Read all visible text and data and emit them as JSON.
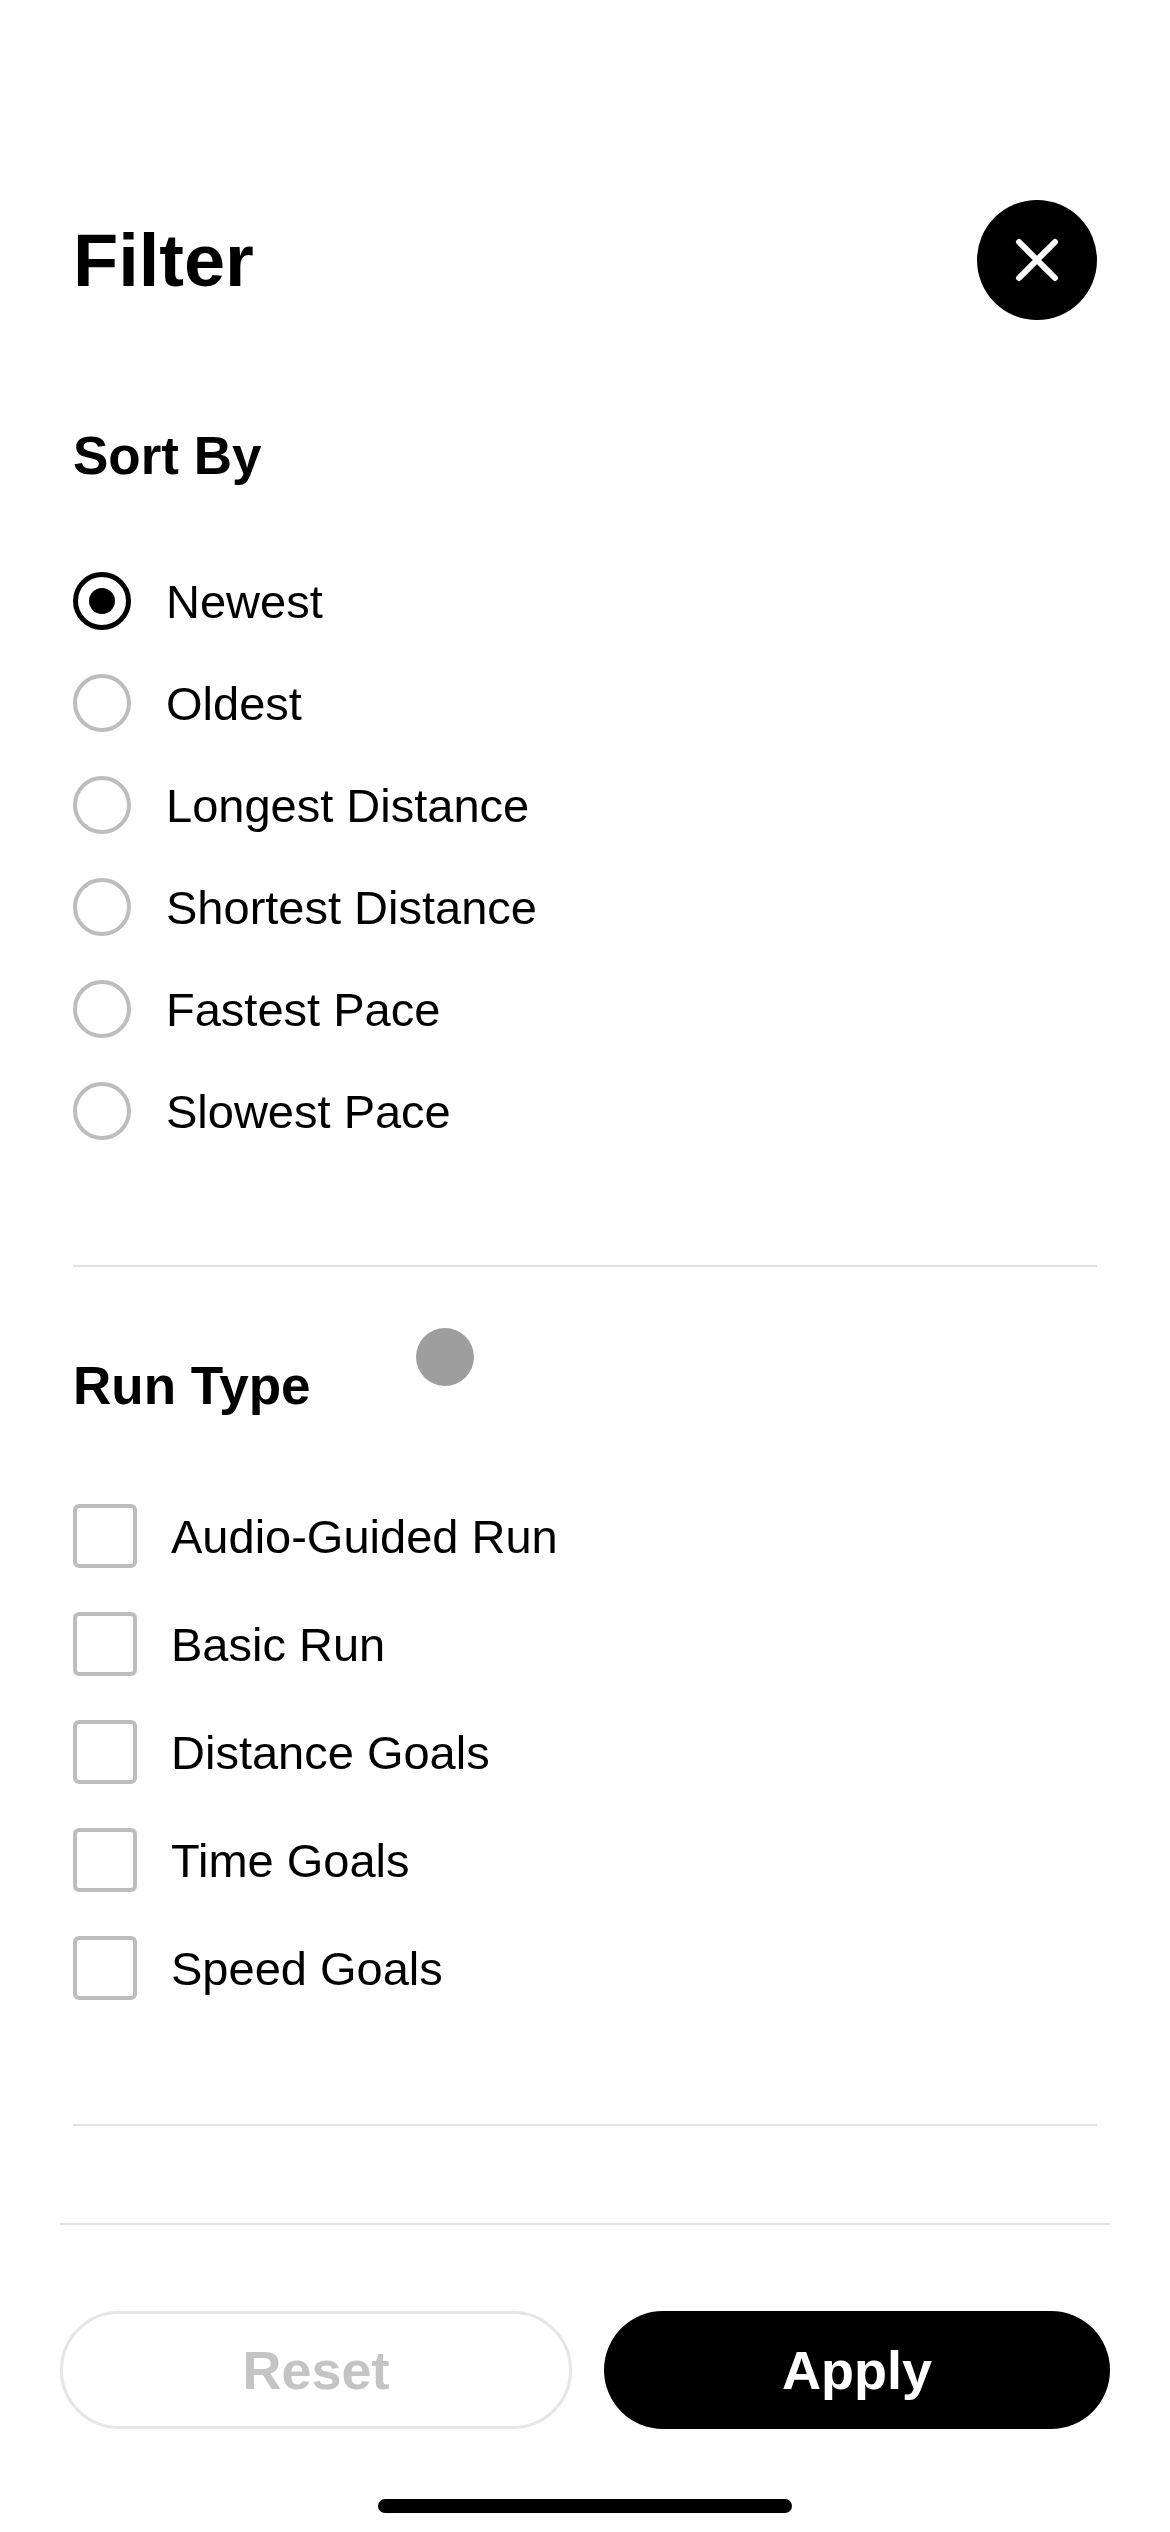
{
  "header": {
    "title": "Filter"
  },
  "sort": {
    "heading": "Sort By",
    "options": [
      {
        "label": "Newest",
        "selected": true
      },
      {
        "label": "Oldest",
        "selected": false
      },
      {
        "label": "Longest Distance",
        "selected": false
      },
      {
        "label": "Shortest Distance",
        "selected": false
      },
      {
        "label": "Fastest Pace",
        "selected": false
      },
      {
        "label": "Slowest Pace",
        "selected": false
      }
    ]
  },
  "run_type": {
    "heading": "Run Type",
    "options": [
      {
        "label": "Audio-Guided Run",
        "checked": false
      },
      {
        "label": "Basic Run",
        "checked": false
      },
      {
        "label": "Distance Goals",
        "checked": false
      },
      {
        "label": "Time Goals",
        "checked": false
      },
      {
        "label": "Speed Goals",
        "checked": false
      }
    ]
  },
  "footer": {
    "buttons": [
      {
        "label": "Reset",
        "disabled": true
      },
      {
        "label": "Apply",
        "disabled": false
      }
    ]
  }
}
